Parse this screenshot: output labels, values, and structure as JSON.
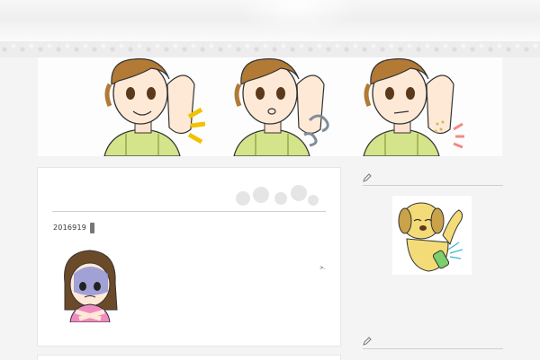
{
  "page": {
    "background_color": "#f4f4f4",
    "accent_rule_color": "#cfcfcf"
  },
  "header": {
    "banner_panels": [
      {
        "name": "smile",
        "accent": "#f2c200"
      },
      {
        "name": "worried-smell",
        "accent": "#7f8c9a"
      },
      {
        "name": "sweaty",
        "accent": "#f28b82"
      }
    ]
  },
  "main": {
    "post_date": "2016919",
    "read_more_mark": ">.",
    "thumbnail_icon": "girl-covering-chest-illustration"
  },
  "sidebar": {
    "widget_icon": "pen-icon",
    "image_icon": "dog-deodorant-illustration"
  }
}
